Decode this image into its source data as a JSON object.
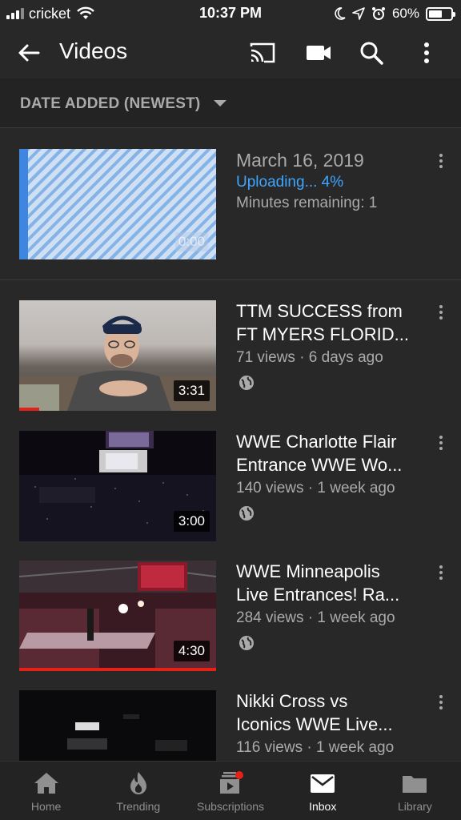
{
  "status": {
    "carrier": "cricket",
    "time": "10:37 PM",
    "battery": "60%",
    "battery_level": 0.6
  },
  "app_bar": {
    "title": "Videos",
    "icons": [
      "back-arrow-icon",
      "cast-icon",
      "video-camera-icon",
      "search-icon",
      "more-vert-icon"
    ]
  },
  "sort": {
    "label": "DATE ADDED (NEWEST)"
  },
  "upload": {
    "date": "March 16, 2019",
    "status": "Uploading... 4%",
    "remaining": "Minutes remaining: 1",
    "duration": "0:00",
    "progress": 0.04,
    "status_color": "#3ea6ff"
  },
  "videos": [
    {
      "title_line1": "TTM SUCCESS from",
      "title_line2": "FT MYERS FLORID...",
      "meta": "71 views · 6 days ago",
      "duration": "3:31",
      "watched": 0.1
    },
    {
      "title_line1": "WWE Charlotte Flair",
      "title_line2": "Entrance WWE Wo...",
      "meta": "140 views · 1 week ago",
      "duration": "3:00",
      "watched": 0
    },
    {
      "title_line1": "WWE Minneapolis",
      "title_line2": "Live Entrances! Ra...",
      "meta": "284 views · 1 week ago",
      "duration": "4:30",
      "watched": 1.0
    },
    {
      "title_line1": "Nikki Cross vs",
      "title_line2": "Iconics WWE Live...",
      "meta": "116 views · 1 week ago",
      "duration": "",
      "watched": 0
    }
  ],
  "bottom_nav": {
    "items": [
      {
        "label": "Home",
        "icon": "home-icon"
      },
      {
        "label": "Trending",
        "icon": "trending-flame-icon"
      },
      {
        "label": "Subscriptions",
        "icon": "subscriptions-icon"
      },
      {
        "label": "Inbox",
        "icon": "inbox-mail-icon"
      },
      {
        "label": "Library",
        "icon": "library-folder-icon"
      }
    ],
    "active": "Inbox"
  },
  "colors": {
    "background": "#282828",
    "accent_red": "#e62117",
    "upload_blue": "#3ea6ff"
  }
}
